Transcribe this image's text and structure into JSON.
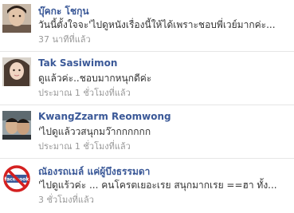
{
  "comments": [
    {
      "name": "บุ๊คกะ โชกุน",
      "text": "วันนี้ตั้งใจจะ'ไปดูหนังเรื่องนี้ให้ได้เพราะชอบพี่เวย์มากค่ะ...",
      "time": "37 นาทีที่แล้ว",
      "avatar": "profile-photo"
    },
    {
      "name": "Tak Sasiwimon",
      "text": "ดูแล้วค่ะ..ชอบมากหนุกดีค่ะ",
      "time": "ประมาณ 1 ชั่วโมงที่แล้ว",
      "avatar": "profile-photo"
    },
    {
      "name": "KwangZzarm Reomwong",
      "text": "'ไปดูแล้ววสนุกมว๊ากกกกกก",
      "time": "ประมาณ 1 ชั่วโมงที่แล้ว",
      "avatar": "profile-photo"
    },
    {
      "name": "ณัองรถเมล์ แค่ผู้บึงธรรมดา",
      "text": "'ไปดูแร้วค่ะ ... คนโครตเยอะเรย สนุกมากเรย ==ฮา ทั้ง...",
      "time": "3 ชั่วโมงที่แล้ว",
      "avatar": "no-facebook-logo",
      "avatar_text": "facebook"
    }
  ],
  "colors": {
    "name": "#3b5998",
    "text": "#333333",
    "time": "#999999",
    "divider": "#e6e6e6"
  }
}
